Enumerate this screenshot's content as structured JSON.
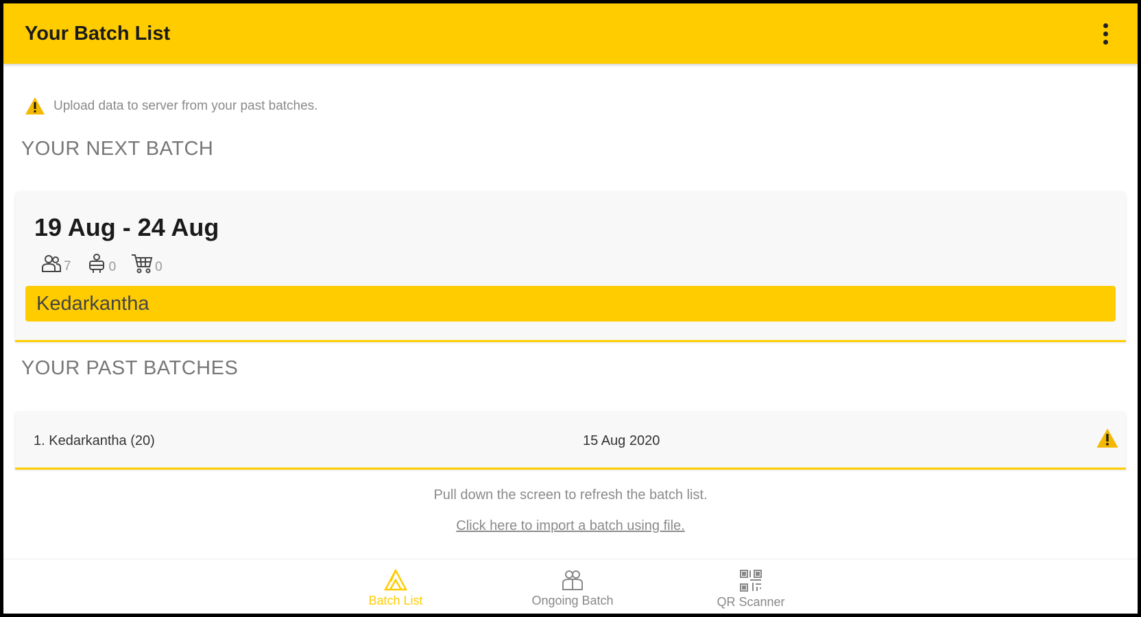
{
  "appbar": {
    "title": "Your Batch List"
  },
  "warning": {
    "text": "Upload data to server from your past batches."
  },
  "next_batch": {
    "section_title": "YOUR NEXT BATCH",
    "dates": "19 Aug - 24 Aug",
    "stats": {
      "participants": "7",
      "staff": "0",
      "cart": "0"
    },
    "trek_name": "Kedarkantha"
  },
  "past_batches": {
    "section_title": "YOUR PAST BATCHES",
    "items": [
      {
        "name": "1. Kedarkantha (20)",
        "date": "15 Aug 2020"
      }
    ]
  },
  "footer": {
    "refresh_hint": "Pull down the screen to refresh the batch list.",
    "import_link": "Click here to import a batch using file."
  },
  "bottom_nav": {
    "items": [
      {
        "label": "Batch List",
        "icon": "tent-icon"
      },
      {
        "label": "Ongoing Batch",
        "icon": "group-icon"
      },
      {
        "label": "QR Scanner",
        "icon": "qr-code-icon"
      }
    ]
  },
  "colors": {
    "accent": "#FFCC00",
    "warning": "#F5B800"
  }
}
